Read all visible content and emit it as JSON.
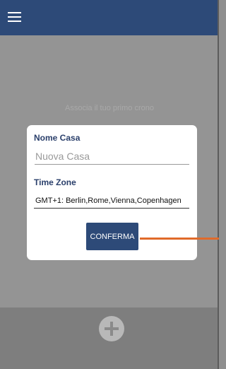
{
  "colors": {
    "header": "#2d4a78",
    "overlay": "#949494",
    "accent_pointer": "#e06a2a",
    "button": "#2d4a78"
  },
  "header": {
    "menu_icon": "hamburger-icon"
  },
  "main": {
    "empty_message": "Associa il tuo primo crono"
  },
  "dialog": {
    "name_label": "Nome Casa",
    "name_placeholder": "Nuova Casa",
    "name_value": "",
    "timezone_label": "Time Zone",
    "timezone_value": "GMT+1:  Berlin,Rome,Vienna,Copenhagen",
    "confirm_label": "CONFERMA"
  },
  "bottom": {
    "add_icon": "plus-icon"
  }
}
